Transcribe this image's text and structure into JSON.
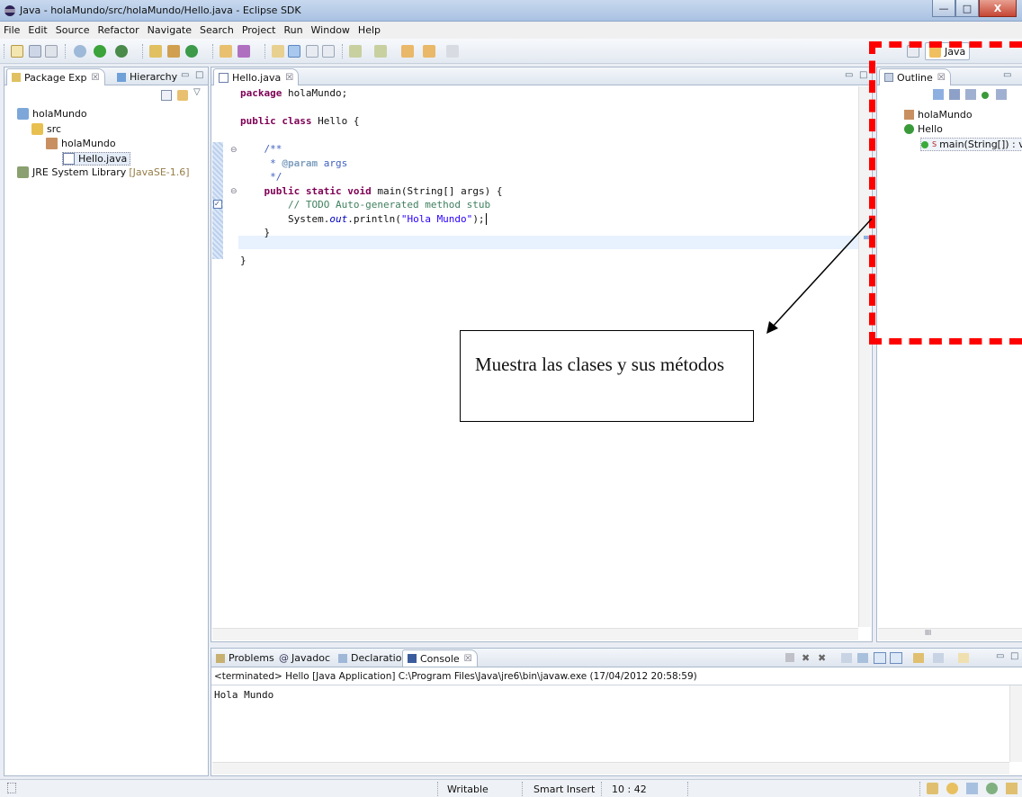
{
  "window": {
    "title": "Java - holaMundo/src/holaMundo/Hello.java - Eclipse SDK",
    "min_glyph": "—",
    "max_glyph": "□",
    "close_glyph": "X"
  },
  "menu": [
    "File",
    "Edit",
    "Source",
    "Refactor",
    "Navigate",
    "Search",
    "Project",
    "Run",
    "Window",
    "Help"
  ],
  "perspective": {
    "label": "Java"
  },
  "left_panel": {
    "tabs": [
      {
        "label": "Package Exp",
        "close": "☒"
      },
      {
        "label": "Hierarchy"
      }
    ],
    "tree": [
      {
        "label": "holaMundo"
      },
      {
        "label": "src"
      },
      {
        "label": "holaMundo"
      },
      {
        "label": "Hello.java"
      },
      {
        "label": "JRE System Library",
        "suffix": "[JavaSE-1.6]"
      }
    ]
  },
  "editor": {
    "tab": {
      "label": "Hello.java",
      "close": "☒"
    },
    "code": [
      "package holaMundo;",
      "",
      "public class Hello {",
      "",
      "    /**",
      "     * @param args",
      "     */",
      "    public static void main(String[] args) {",
      "        // TODO Auto-generated method stub",
      "        System.out.println(\"Hola Mundo\");",
      "    }",
      "",
      "}"
    ]
  },
  "outline": {
    "tab": {
      "label": "Outline",
      "close": "☒"
    },
    "items": [
      {
        "label": "holaMundo"
      },
      {
        "label": "Hello"
      },
      {
        "label": "main(String[]) : vo",
        "modifier": "S"
      }
    ]
  },
  "bottom_panel": {
    "tabs": [
      {
        "label": "Problems"
      },
      {
        "label": "Javadoc"
      },
      {
        "label": "Declaration"
      },
      {
        "label": "Console",
        "close": "☒"
      }
    ],
    "console_header": "<terminated> Hello [Java Application] C:\\Program Files\\Java\\jre6\\bin\\javaw.exe (17/04/2012 20:58:59)",
    "console_output": "Hola Mundo",
    "scroll_thumb": "III"
  },
  "statusbar": {
    "writable": "Writable",
    "insert_mode": "Smart Insert",
    "position": "10 : 42"
  },
  "annotation": {
    "text": "Muestra las clases y sus métodos"
  },
  "colors": {
    "annotation_dash": "#ff0000",
    "keyword": "#7f0055",
    "comment": "#3f7f5f",
    "string": "#2a00ff"
  }
}
